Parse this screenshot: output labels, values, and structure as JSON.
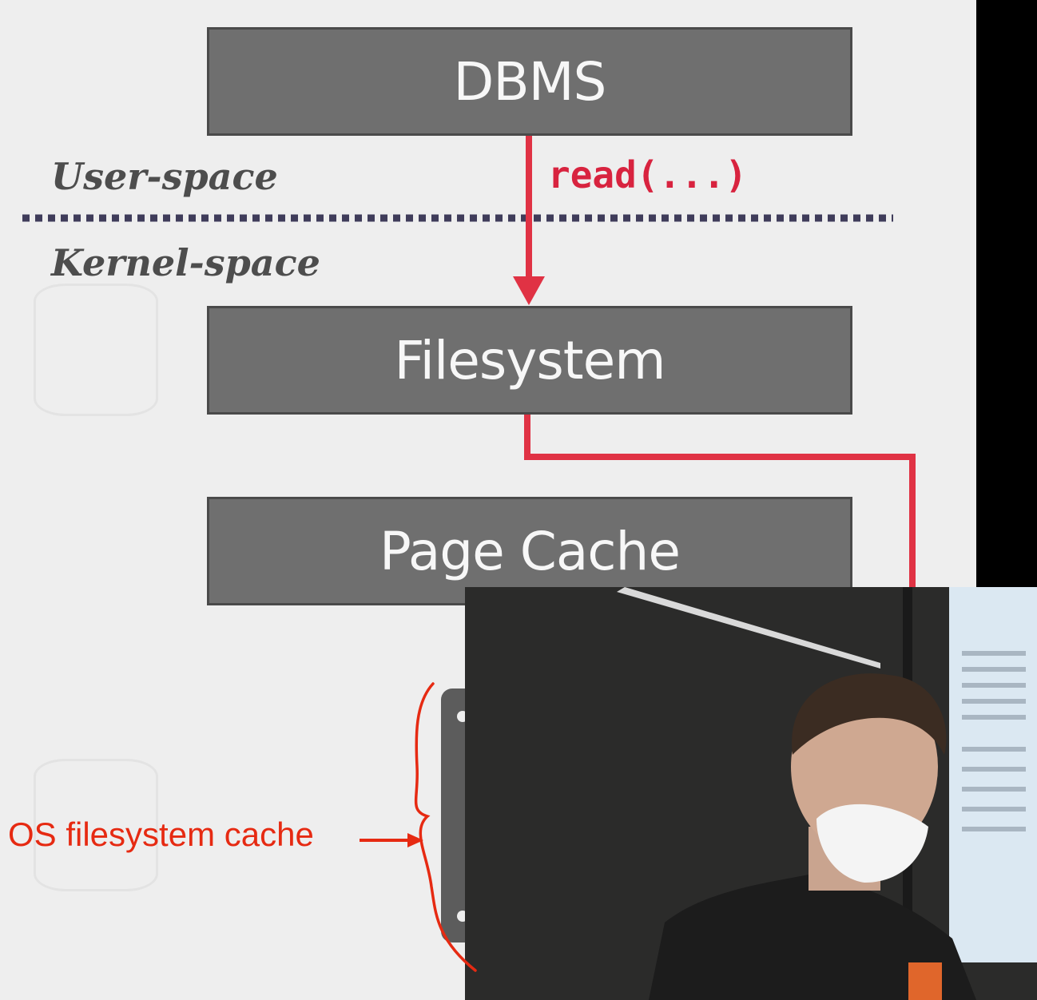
{
  "diagram": {
    "boxes": {
      "dbms": "DBMS",
      "filesystem": "Filesystem",
      "page_cache": "Page Cache"
    },
    "user_space_label": "User-space",
    "kernel_space_label": "Kernel-space",
    "call_label": "read(...)"
  },
  "annotation": {
    "text": "OS filesystem cache"
  },
  "colors": {
    "box_fill": "#6f6f6f",
    "arrow_red": "#e03244",
    "divider": "#3f3c5a",
    "annotation_red": "#e62a12"
  }
}
